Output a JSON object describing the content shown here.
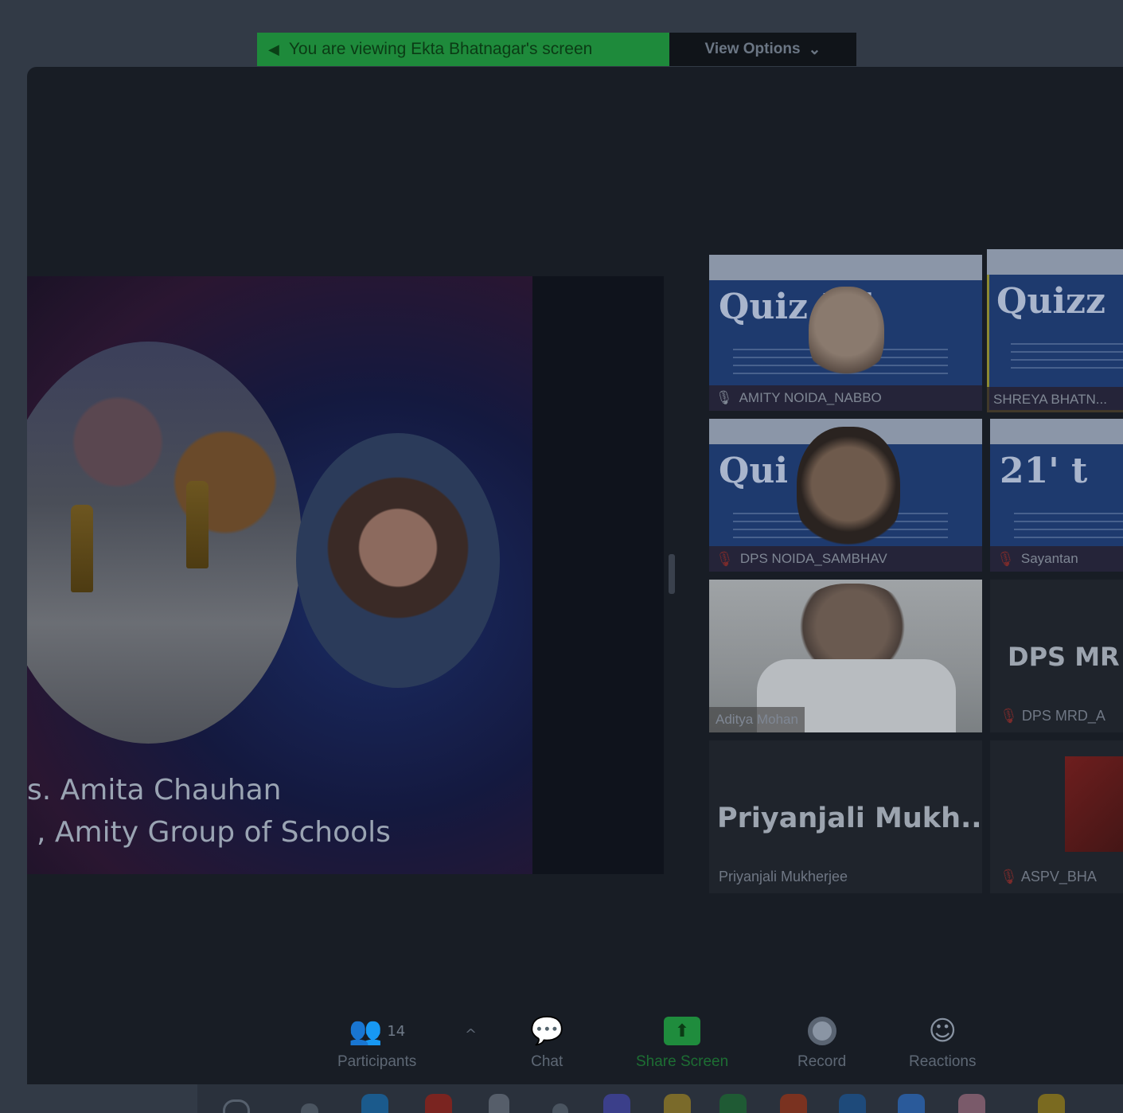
{
  "share_banner": {
    "message": "You are viewing Ekta Bhatnagar's screen",
    "view_options_label": "View Options",
    "view_options_chevron": "chevron-down-icon"
  },
  "slide": {
    "name_line": "s. Amita Chauhan",
    "title_line": ", Amity Group of Schools"
  },
  "gallery": [
    {
      "quiz_word": "Quiz  '21",
      "name": "AMITY NOIDA_NABBO",
      "muted": false
    },
    {
      "quiz_word": "Quizz",
      "name": "SHREYA BHATN...",
      "muted": true
    },
    {
      "quiz_word": "Qui     21",
      "name": "DPS NOIDA_SAMBHAV",
      "muted": true
    },
    {
      "quiz_word": "21' t",
      "name": "Sayantan",
      "muted": true
    },
    {
      "name": "Aditya Mohan"
    },
    {
      "display_name": "DPS MR",
      "name": "DPS MRD_A",
      "muted": true
    },
    {
      "display_name": "Priyanjali  Mukh...",
      "name": "Priyanjali Mukherjee"
    },
    {
      "name": "ASPV_BHA",
      "muted": true
    }
  ],
  "toolbar": {
    "participants_label": "Participants",
    "participants_count": "14",
    "chat_label": "Chat",
    "share_screen_label": "Share Screen",
    "record_label": "Record",
    "reactions_label": "Reactions"
  },
  "colors": {
    "share_green": "#1e8a3b",
    "meeting_bg": "#181d25",
    "muted_red": "#7a2b2b"
  }
}
